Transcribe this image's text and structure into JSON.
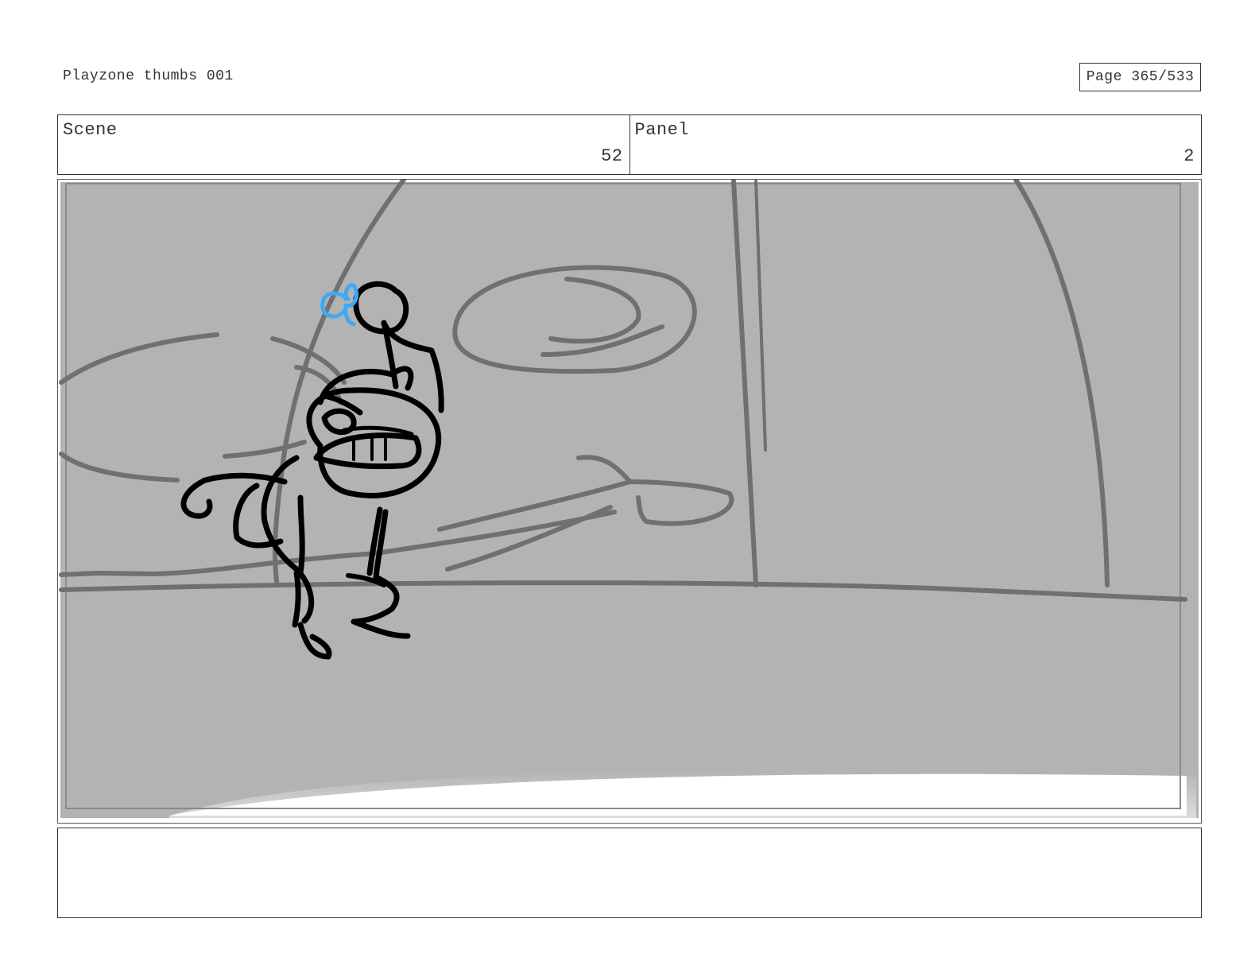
{
  "header": {
    "title": "Playzone thumbs 001",
    "page": "Page 365/533"
  },
  "info": {
    "scene_label": "Scene",
    "scene_value": "52",
    "panel_label": "Panel",
    "panel_value": "2"
  },
  "panel_image": {
    "description_icon": "storyboard-sketch",
    "background_color": "#b3b3b3",
    "line_color": "#707070",
    "figure_color": "#000000",
    "accent_color": "#3fa9f5"
  },
  "notes": {
    "text": ""
  }
}
